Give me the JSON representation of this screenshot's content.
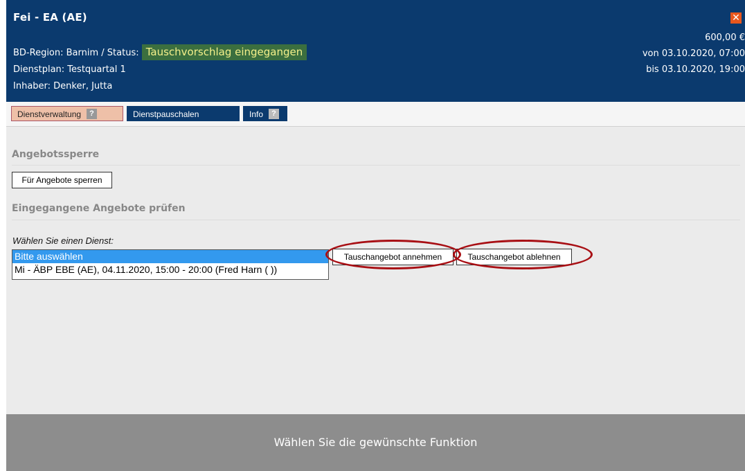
{
  "header": {
    "title": "Fei - EA (AE)",
    "region_status_prefix": "BD-Region: Barnim / Status: ",
    "status": "Tauschvorschlag eingegangen",
    "dienstplan": "Dienstplan: Testquartal 1",
    "inhaber": "Inhaber: Denker, Jutta",
    "price": "600,00 €",
    "from": "von 03.10.2020, 07:00",
    "to": "bis 03.10.2020, 19:00",
    "close_icon": "close-icon",
    "close_color": "#e8571d",
    "status_bg": "#3b6f3f",
    "status_fg": "#f4f08a",
    "bg_color": "#0b3a6e"
  },
  "tabs": [
    {
      "label": "Dienstverwaltung",
      "active": true,
      "help": "?"
    },
    {
      "label": "Dienstpauschalen",
      "active": false
    },
    {
      "label": "Info",
      "active": false,
      "help": "?"
    }
  ],
  "angebotssperre": {
    "title": "Angebotssperre",
    "button_label": "Für Angebote sperren"
  },
  "angebote": {
    "title": "Eingegangene Angebote prüfen",
    "select_label": "Wählen Sie einen Dienst:",
    "options": [
      "Bitte auswählen",
      "Mi - ÄBP EBE (AE), 04.11.2020, 15:00 - 20:00 (Fred Harn ( ))"
    ],
    "selected_index": 0,
    "accept_label": "Tauschangebot annehmen",
    "reject_label": "Tauschangebot ablehnen",
    "highlight_color": "#a80f14"
  },
  "footer": {
    "text": "Wählen Sie die gewünschte Funktion"
  }
}
